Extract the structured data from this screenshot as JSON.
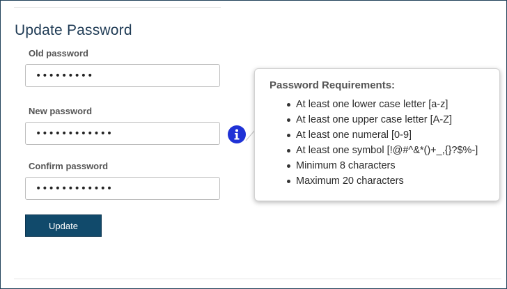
{
  "form": {
    "title": "Update Password",
    "old_password": {
      "label": "Old password",
      "value": "•••••••••"
    },
    "new_password": {
      "label": "New password",
      "value": "••••••••••••"
    },
    "confirm_password": {
      "label": "Confirm password",
      "value": "••••••••••••"
    },
    "submit_label": "Update"
  },
  "info_icon": "info-circle-icon",
  "tooltip": {
    "heading": "Password Requirements:",
    "items": [
      "At least one lower case letter [a-z]",
      "At least one upper case letter [A-Z]",
      "At least one numeral [0-9]",
      "At least one symbol [!@#^&*()+_,{}?$%-]",
      "Minimum 8 characters",
      "Maximum 20 characters"
    ]
  },
  "colors": {
    "button_bg": "#114a6b",
    "info_icon_bg": "#1f32d6",
    "title_text": "#1f3b55",
    "frame_border": "#21425a"
  }
}
